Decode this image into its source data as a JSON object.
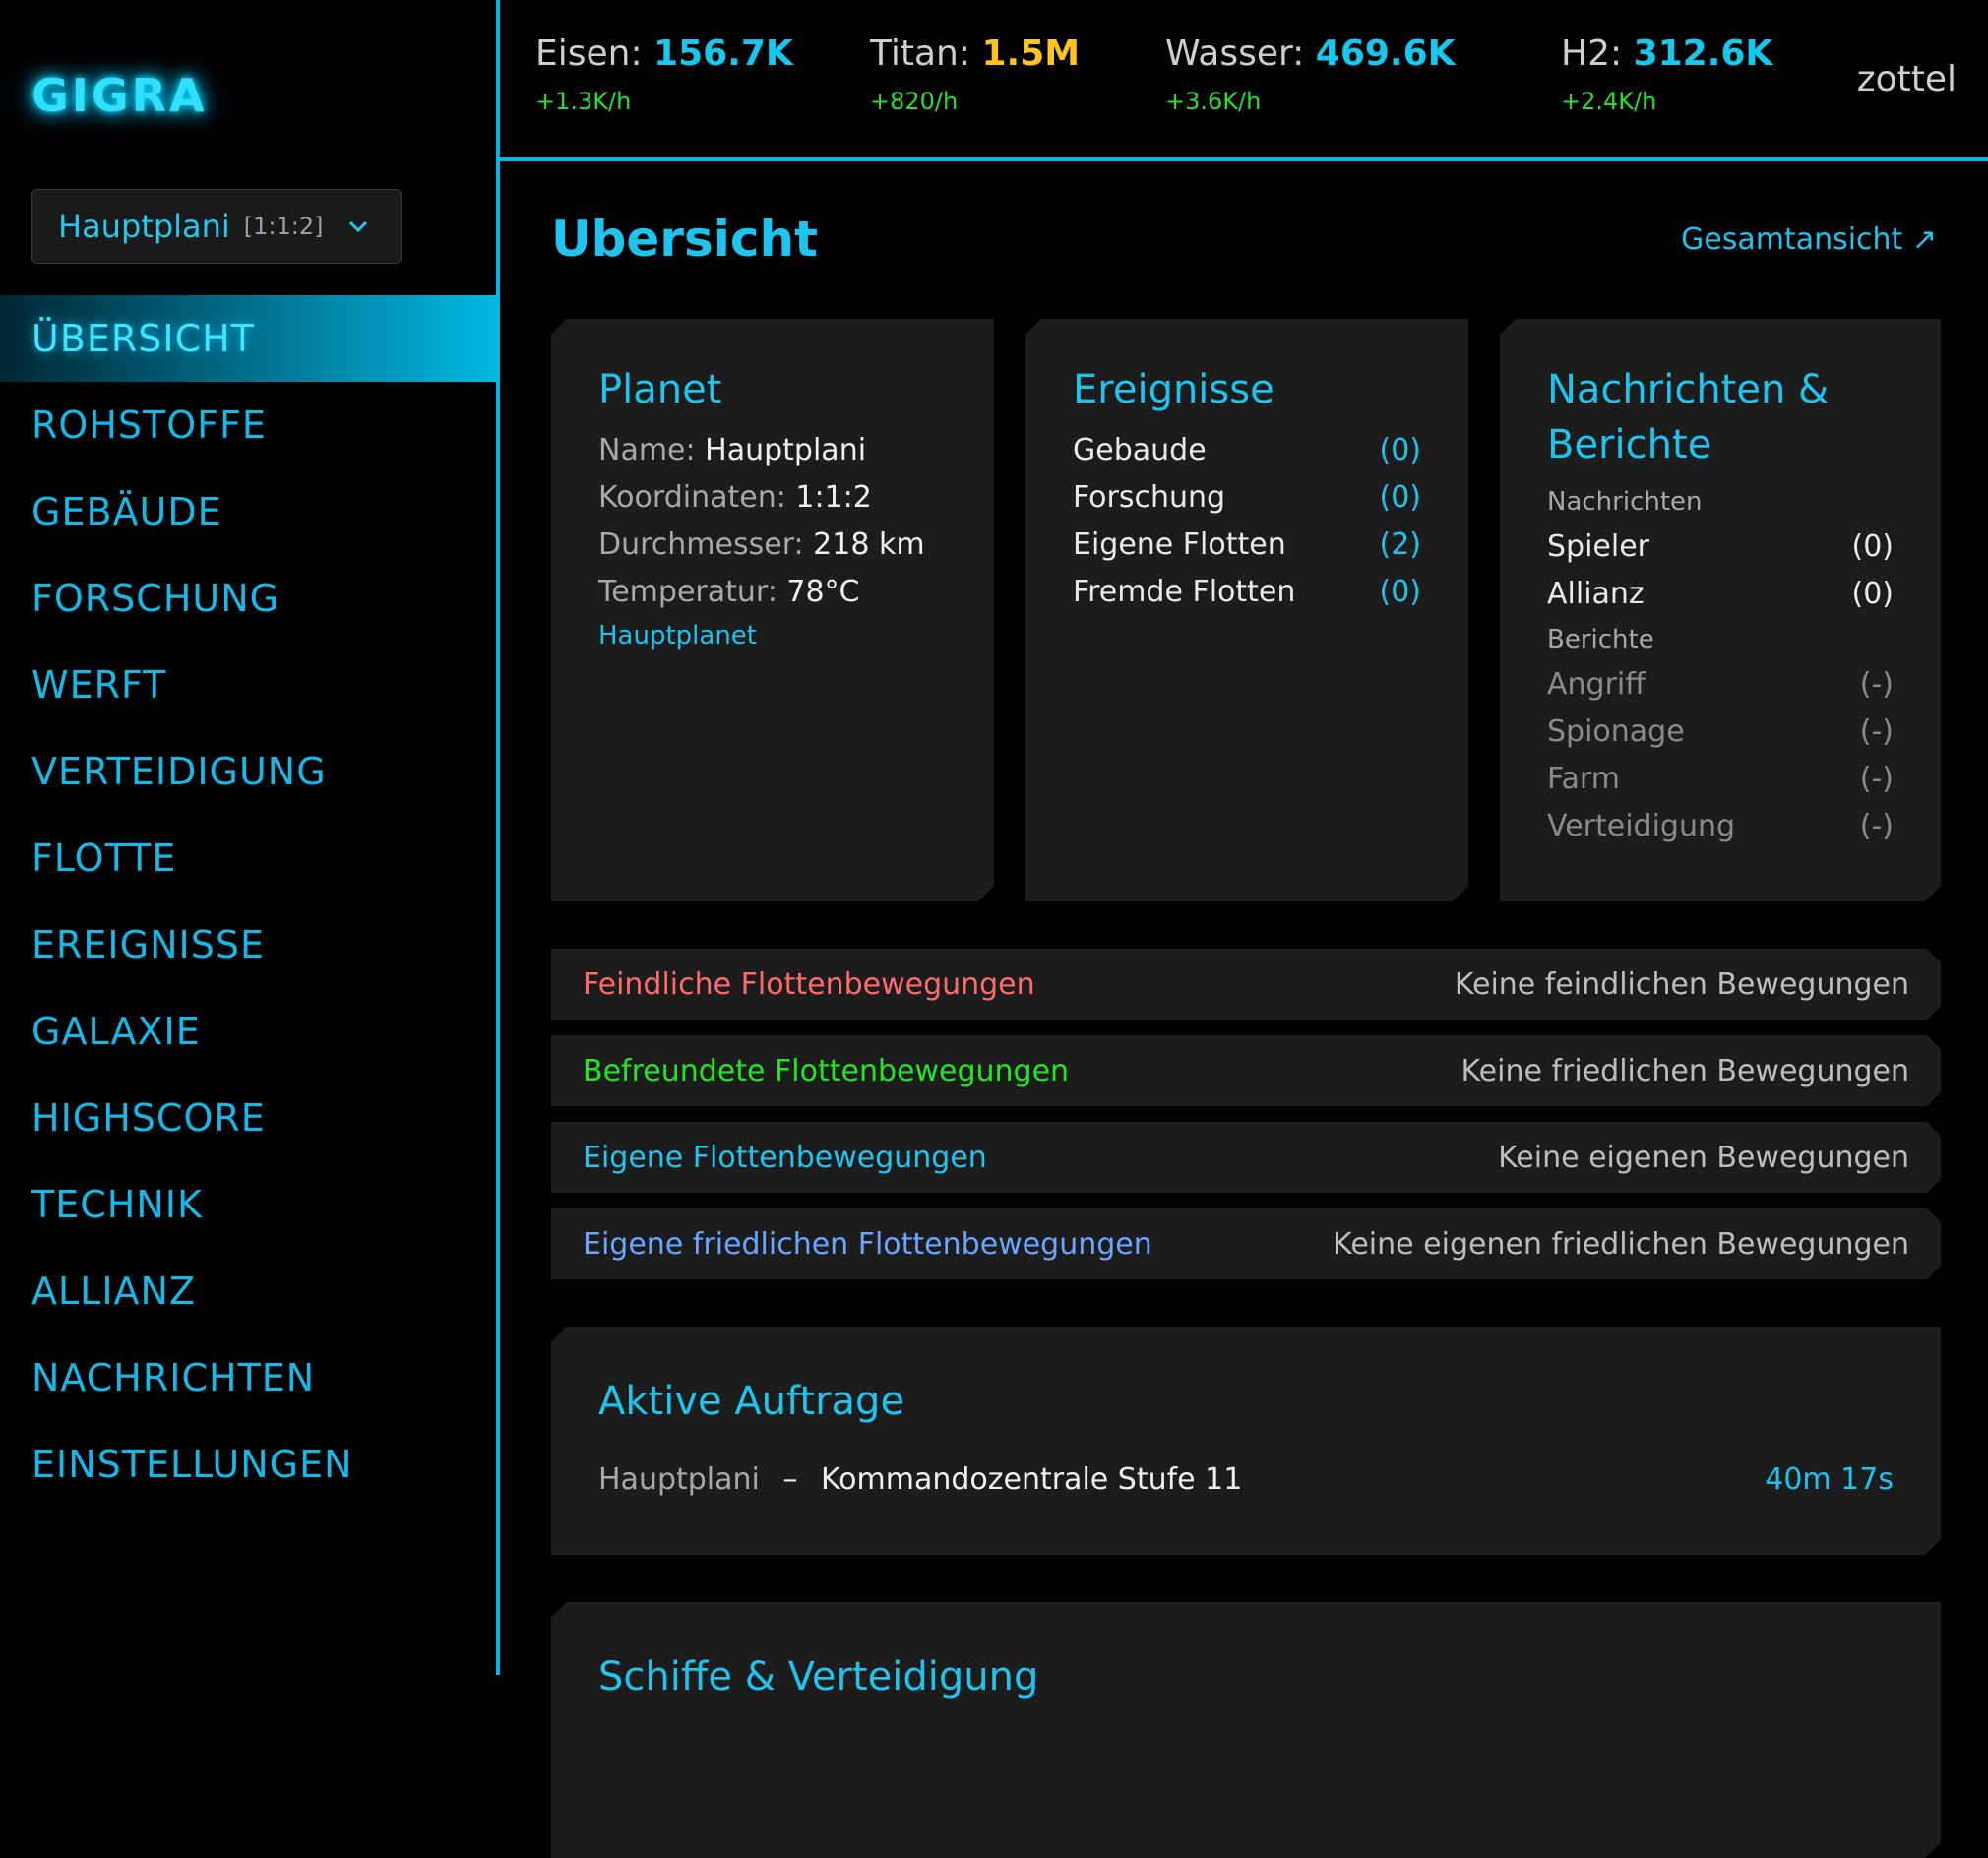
{
  "app": {
    "logo": "GIGRA"
  },
  "planet_selector": {
    "name": "Hauptplani",
    "coords": "[1:1:2]"
  },
  "nav": [
    "ÜBERSICHT",
    "ROHSTOFFE",
    "GEBÄUDE",
    "FORSCHUNG",
    "WERFT",
    "VERTEIDIGUNG",
    "FLOTTE",
    "EREIGNISSE",
    "GALAXIE",
    "HIGHSCORE",
    "TECHNIK",
    "ALLIANZ",
    "NACHRICHTEN",
    "EINSTELLUNGEN"
  ],
  "resources": [
    {
      "label": "Eisen:",
      "value": "156.7K",
      "rate": "+1.3K/h"
    },
    {
      "label": "Titan:",
      "value": "1.5M",
      "rate": "+820/h"
    },
    {
      "label": "Wasser:",
      "value": "469.6K",
      "rate": "+3.6K/h"
    },
    {
      "label": "H2:",
      "value": "312.6K",
      "rate": "+2.4K/h"
    }
  ],
  "user": {
    "name": "zottel"
  },
  "page": {
    "title": "Ubersicht",
    "overview_link": "Gesamtansicht ↗"
  },
  "planet_card": {
    "title": "Planet",
    "name_label": "Name:",
    "name_value": "Hauptplani",
    "coords_label": "Koordinaten:",
    "coords_value": "1:1:2",
    "diameter_label": "Durchmesser:",
    "diameter_value": "218 km",
    "temp_label": "Temperatur:",
    "temp_value": "78°C",
    "main_link": "Hauptplanet"
  },
  "events_card": {
    "title": "Ereignisse",
    "rows": [
      {
        "label": "Gebaude",
        "count": "(0)"
      },
      {
        "label": "Forschung",
        "count": "(0)"
      },
      {
        "label": "Eigene Flotten",
        "count": "(2)"
      },
      {
        "label": "Fremde Flotten",
        "count": "(0)"
      }
    ]
  },
  "messages_card": {
    "title_line1": "Nachrichten &",
    "title_line2": "Berichte",
    "messages_label": "Nachrichten",
    "messages": [
      {
        "label": "Spieler",
        "count": "(0)"
      },
      {
        "label": "Allianz",
        "count": "(0)"
      }
    ],
    "reports_label": "Berichte",
    "reports": [
      {
        "label": "Angriff",
        "count": "(-)"
      },
      {
        "label": "Spionage",
        "count": "(-)"
      },
      {
        "label": "Farm",
        "count": "(-)"
      },
      {
        "label": "Verteidigung",
        "count": "(-)"
      }
    ]
  },
  "fleet_bars": [
    {
      "label": "Feindliche Flottenbewegungen",
      "status": "Keine feindlichen Bewegungen"
    },
    {
      "label": "Befreundete Flottenbewegungen",
      "status": "Keine friedlichen Bewegungen"
    },
    {
      "label": "Eigene Flottenbewegungen",
      "status": "Keine eigenen Bewegungen"
    },
    {
      "label": "Eigene friedlichen Flottenbewegungen",
      "status": "Keine eigenen friedlichen Bewegungen"
    }
  ],
  "orders": {
    "title": "Aktive Auftrage",
    "planet": "Hauptplani",
    "separator": "–",
    "task": "Kommandozentrale Stufe 11",
    "time": "40m 17s"
  },
  "ships": {
    "title": "Schiffe & Verteidigung"
  },
  "colors": {
    "accent": "#1ec3ee",
    "gold": "#ffc41f",
    "rate_green": "#23e623",
    "enemy_red": "#ff6a6a",
    "own_peaceful_blue": "#6aa6ff"
  }
}
